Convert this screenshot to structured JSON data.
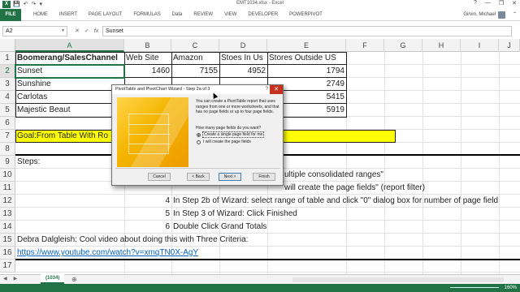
{
  "window": {
    "title": "EMT1034.xlsx - Excel",
    "app_icon": "excel-logo-icon",
    "minimize": "—",
    "restore": "❐",
    "close": "✕",
    "help": "?"
  },
  "qat": {
    "save": "💾",
    "undo": "↶",
    "redo": "↷",
    "more": "▾"
  },
  "ribbon": {
    "file": "FILE",
    "tabs": [
      "HOME",
      "INSERT",
      "PAGE LAYOUT",
      "FORMULAS",
      "Data",
      "REVIEW",
      "VIEW",
      "DEVELOPER",
      "POWERPIVOT"
    ],
    "user": "Girvin, Michael",
    "collapse": "⌃"
  },
  "formula_bar": {
    "name_box": "A2",
    "cancel": "✕",
    "enter": "✓",
    "fx": "fx",
    "value": "Sunset"
  },
  "sheet": {
    "columns": [
      "A",
      "B",
      "C",
      "D",
      "E",
      "F",
      "G",
      "H",
      "I",
      "J"
    ],
    "selected_column": "A",
    "rows": [
      "1",
      "2",
      "3",
      "4",
      "5",
      "6",
      "7",
      "8",
      "9",
      "10",
      "11",
      "12",
      "13",
      "14",
      "15",
      "16",
      "17"
    ],
    "selected_row": "2",
    "header": [
      "Boomerang/SalesChannel",
      "Web Site",
      "Amazon",
      "Stoes In Us",
      "Stores Outside US"
    ],
    "data_rows": [
      {
        "name": "Sunset",
        "web": "1460",
        "amazon": "7155",
        "us": "4952",
        "outside": "1794"
      },
      {
        "name": "Sunshine",
        "web": "",
        "amazon": "",
        "us": "",
        "outside": "2749"
      },
      {
        "name": "Carlotas",
        "web": "",
        "amazon": "",
        "us": "",
        "outside": "5415"
      },
      {
        "name": "Majestic Beaut",
        "web": "",
        "amazon": "",
        "us": "",
        "outside": "5919"
      }
    ],
    "goal": "Goal:From Table With Ro",
    "steps_label": "Steps:",
    "step_numbers": [
      "4",
      "5",
      "6"
    ],
    "step_texts": [
      "ultiple consolidated ranges\"",
      "will create the page fields\" (report filter)",
      "In Step 2b of Wizard: select range of table and click \"0\" dialog box for number of page field",
      "In Step 3 of Wizard: Click Finished",
      "Double Click Grand Totals"
    ],
    "credit": "Debra Dalgleish: Cool video about doing this with Three Criteria:",
    "link": "https://www.youtube.com/watch?v=xmqTN0X-AgY"
  },
  "sheet_tabs": {
    "active": "(1034)",
    "add": "⊕",
    "nav_prev": "◀",
    "nav_next": "▶"
  },
  "status": {
    "zoom": "160%"
  },
  "dialog": {
    "title": "PivotTable and PivotChart Wizard - Step 2a of 3",
    "help": "?",
    "close": "✕",
    "description": "You can create a PivotTable report that uses ranges from one or more worksheets, and that has no page fields or up to four page fields.",
    "question": "How many page fields do you want?",
    "options": [
      "Create a single page field for me",
      "I will create the page fields"
    ],
    "selected_option": 0,
    "buttons": {
      "cancel": "Cancel",
      "back": "< Back",
      "next": "Next >",
      "finish": "Finish"
    }
  },
  "colors": {
    "excel_green": "#217346",
    "highlight": "#ffff00",
    "link": "#0563c1",
    "dialog_art": "#f4b400"
  }
}
